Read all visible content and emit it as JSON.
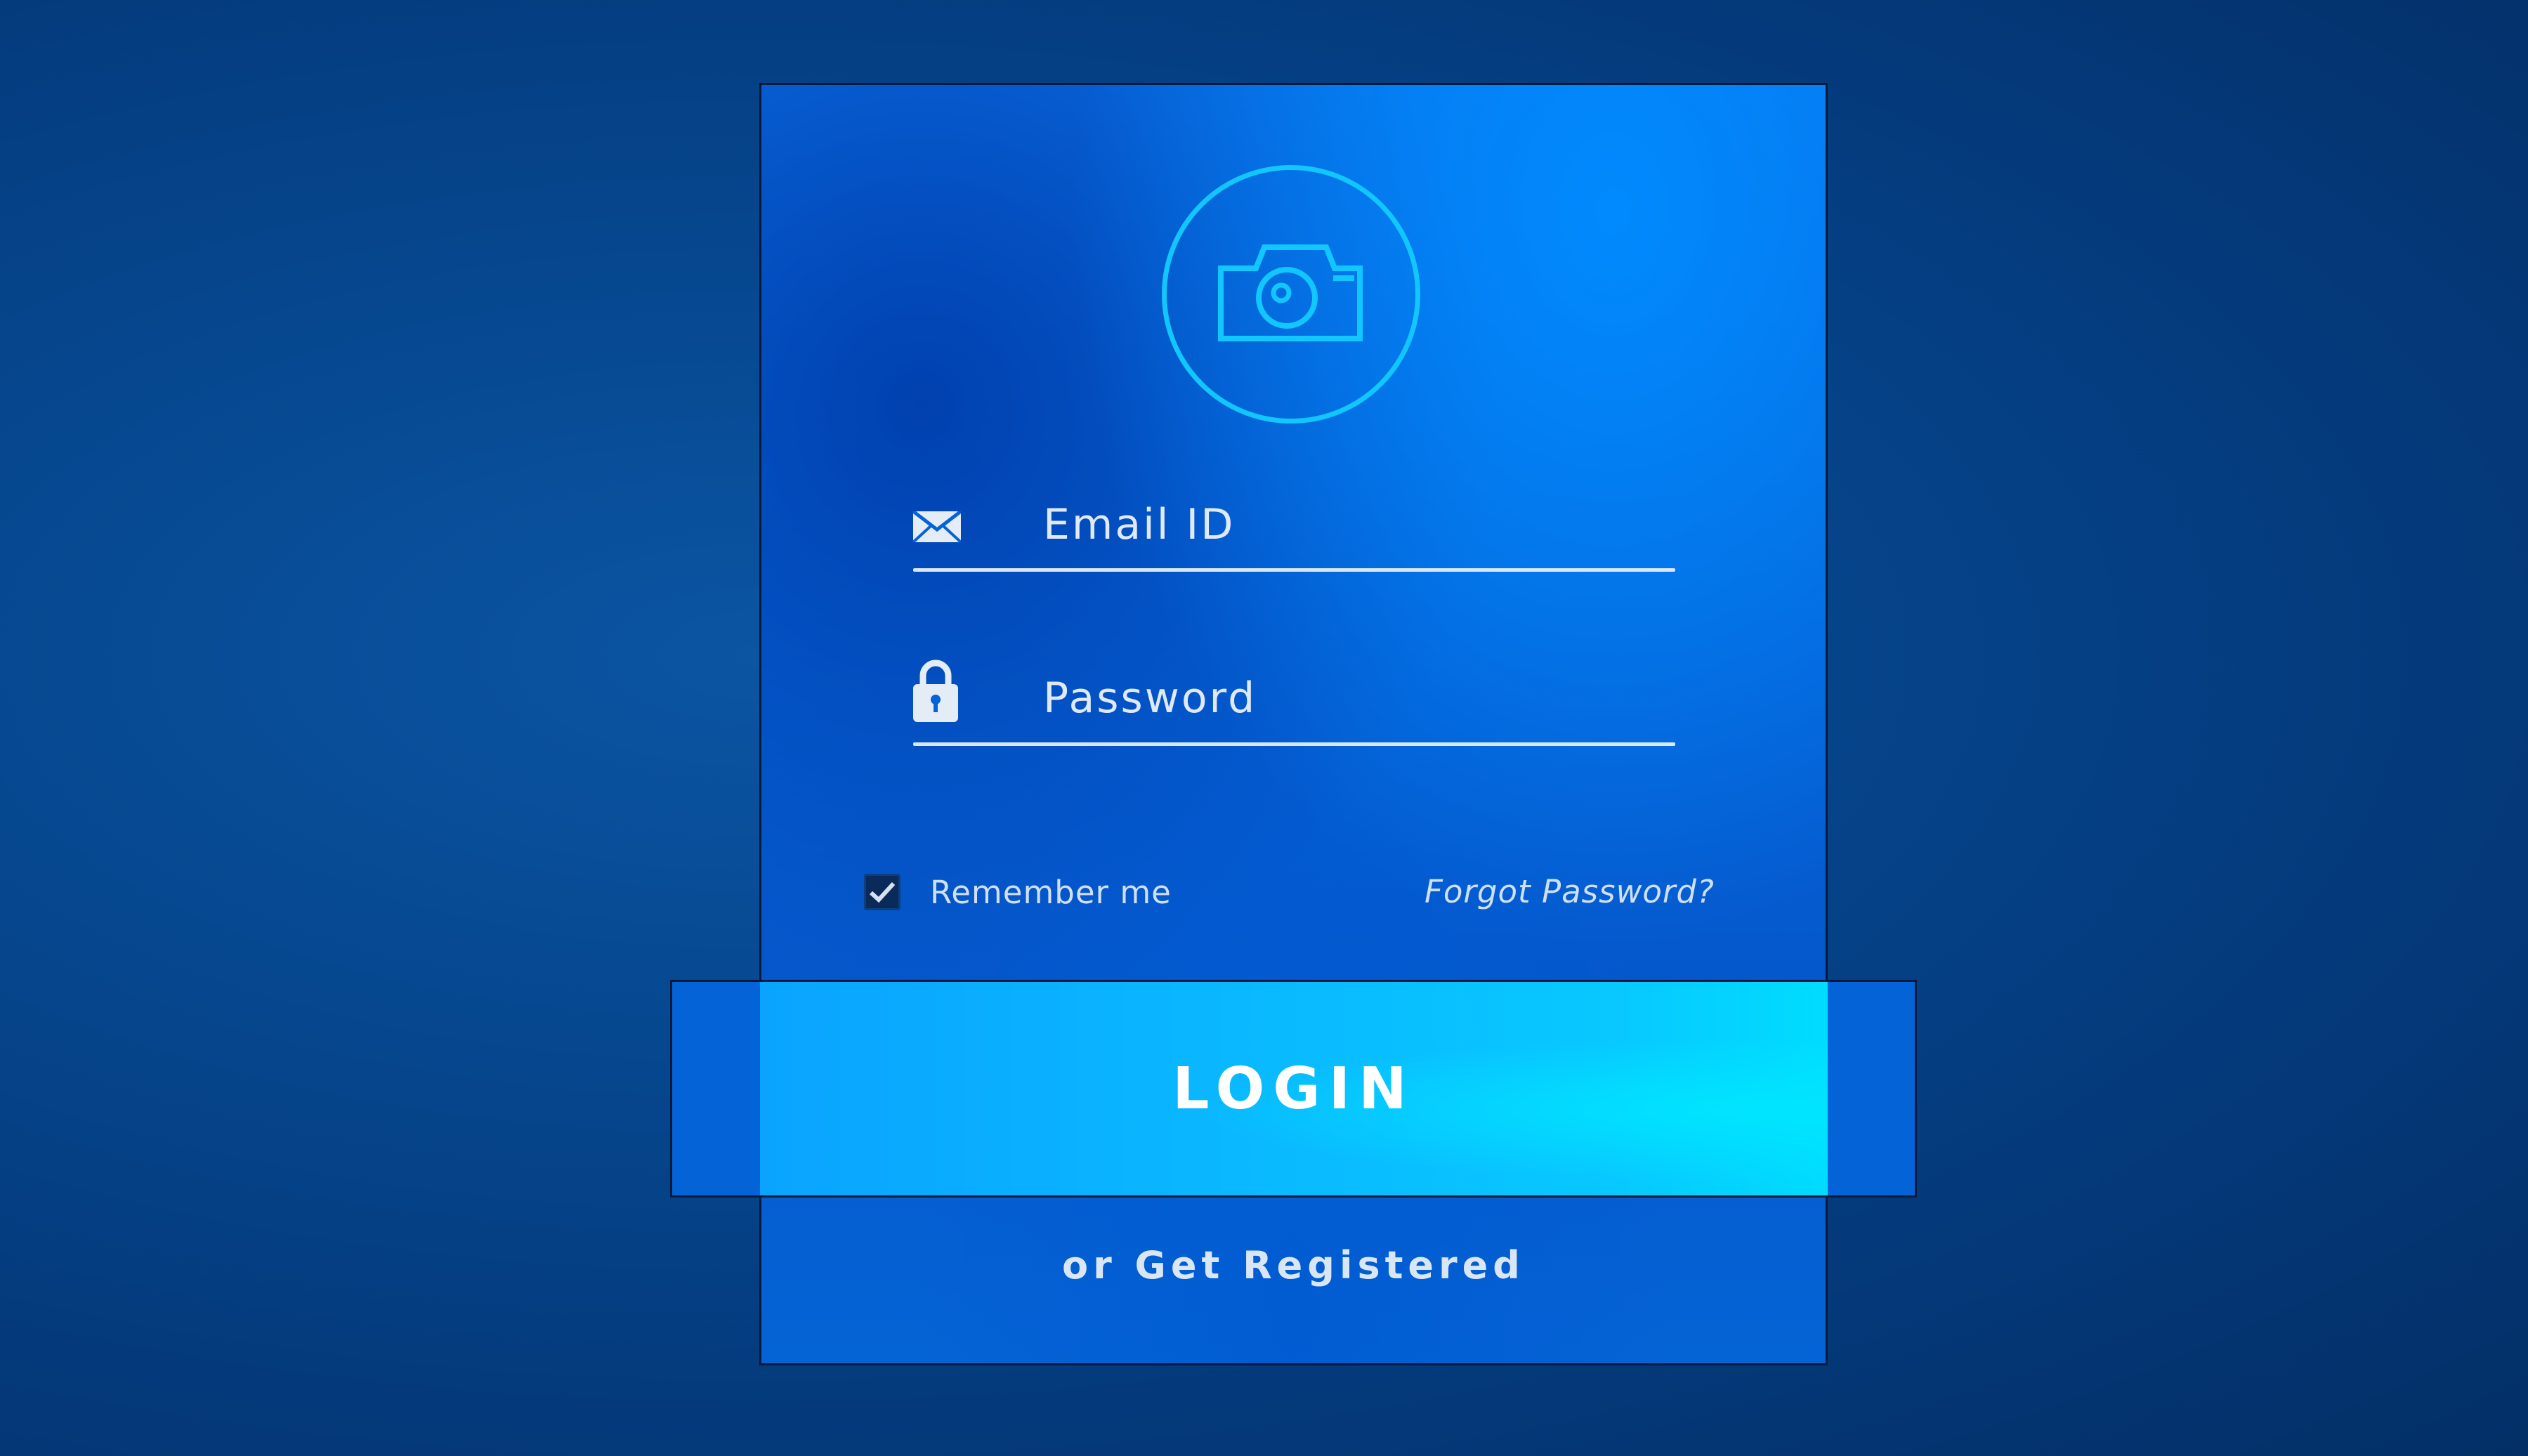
{
  "login_form": {
    "email": {
      "placeholder": "Email ID",
      "value": "",
      "icon": "envelope-icon"
    },
    "password": {
      "placeholder": "Password",
      "value": "",
      "icon": "lock-icon"
    },
    "remember_me": {
      "label": "Remember me",
      "checked": true
    },
    "forgot_password_label": "Forgot Password?",
    "login_button_label": "LOGIN",
    "register_label": "or Get Registered",
    "avatar_icon": "camera-icon"
  },
  "colors": {
    "background": "#04397a",
    "card": "#0563d8",
    "accent_cyan": "#12c6ff",
    "login_button": "#08c8ff",
    "text": "#dfe9f7"
  }
}
